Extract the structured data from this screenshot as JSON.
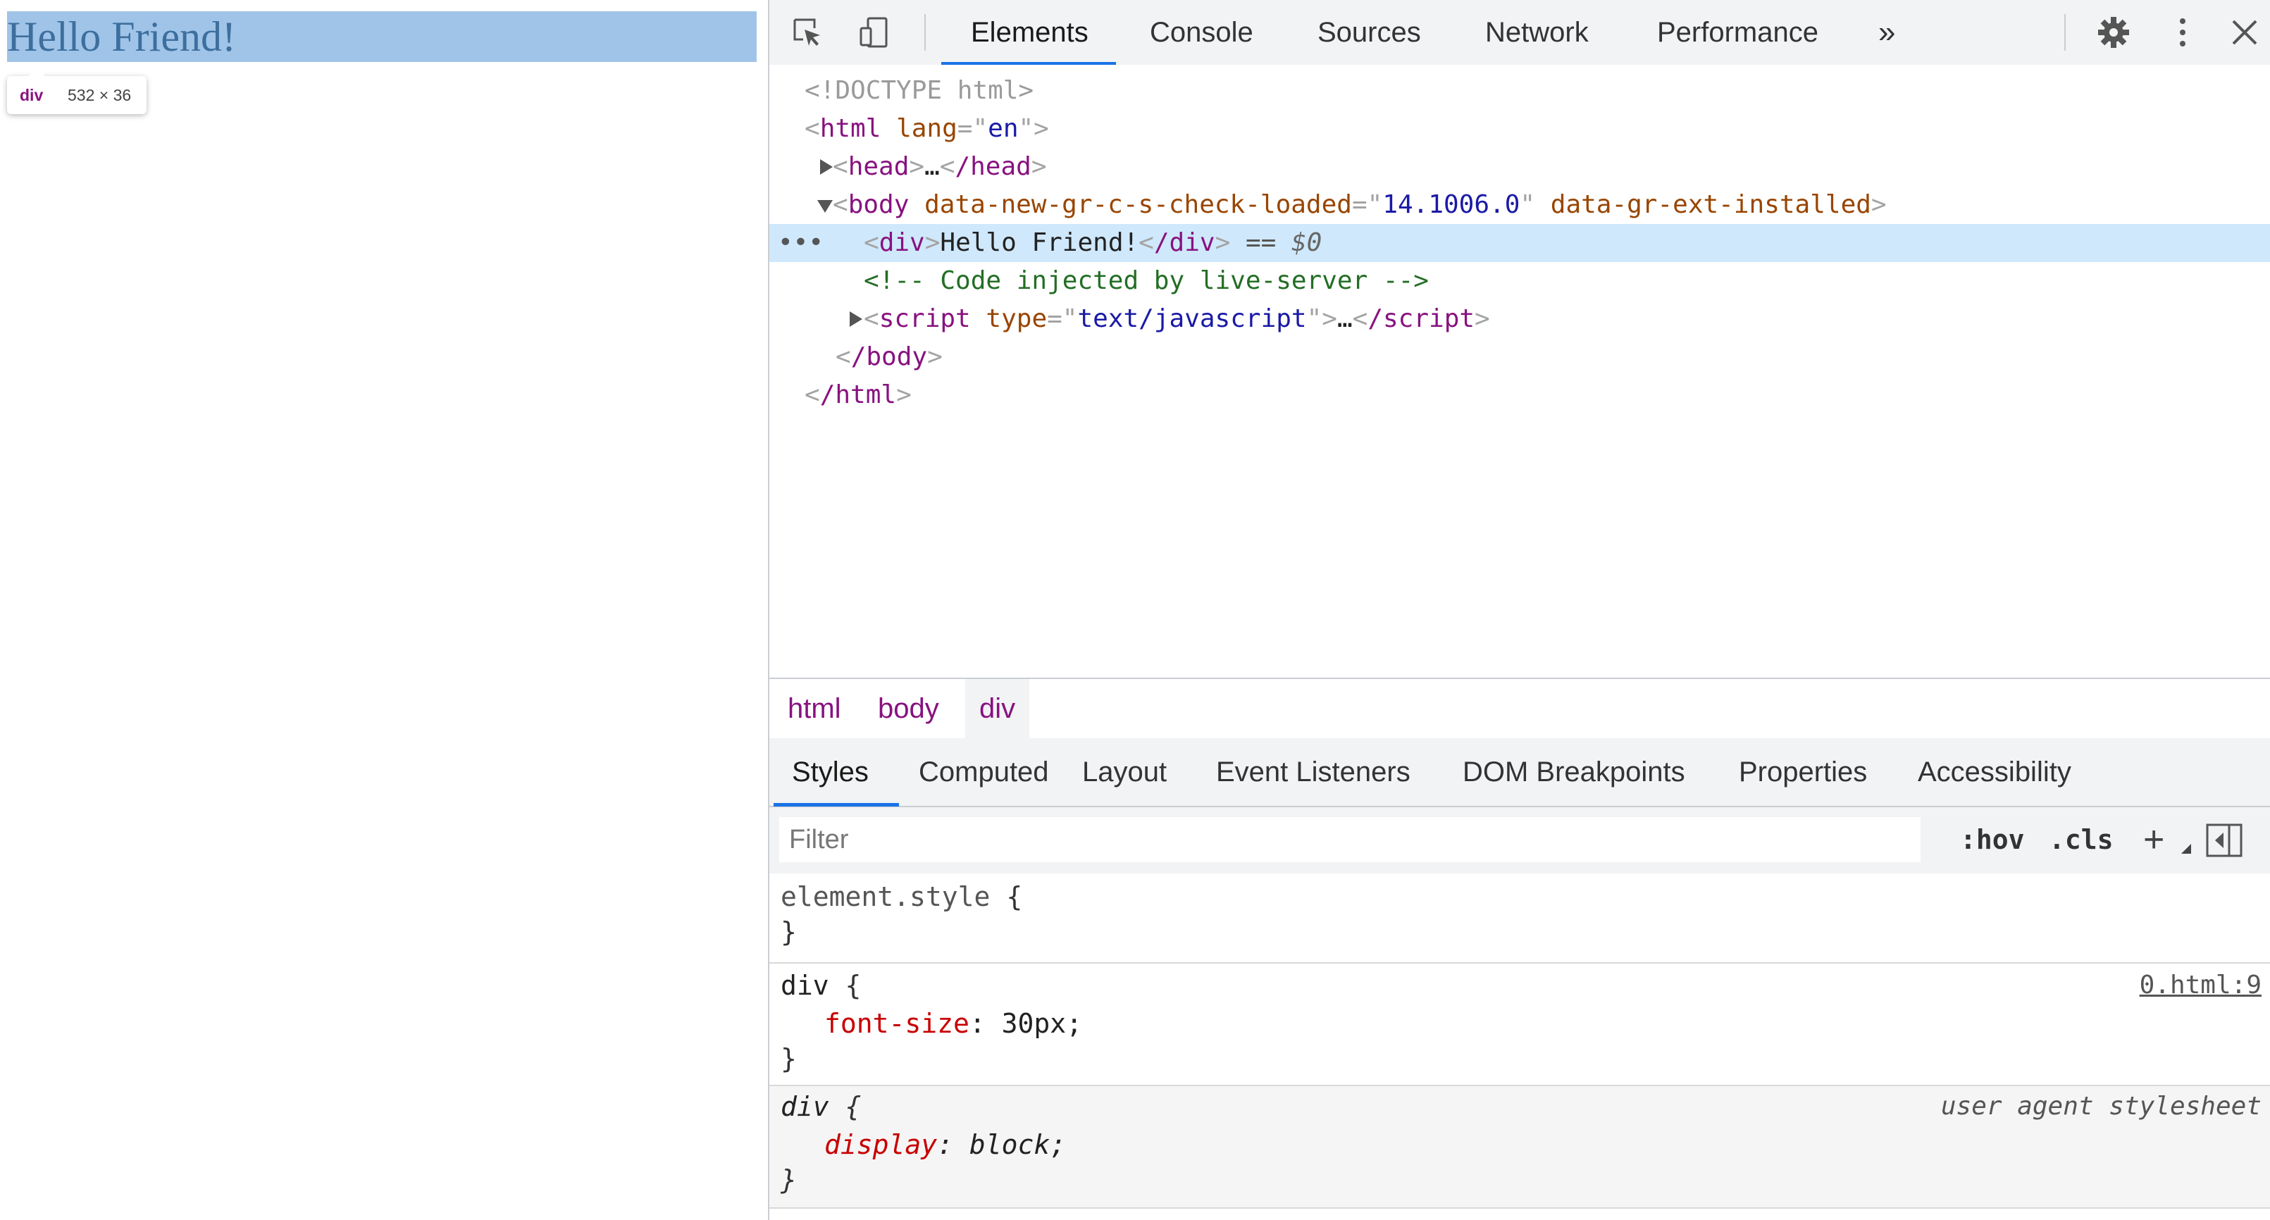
{
  "page": {
    "hello_text": "Hello Friend!",
    "tooltip": {
      "tag": "div",
      "size": "532 × 36"
    }
  },
  "toolbar": {
    "icons": [
      "inspect-element-icon",
      "device-toolbar-icon"
    ],
    "tabs": [
      {
        "label": "Elements",
        "active": true
      },
      {
        "label": "Console"
      },
      {
        "label": "Sources"
      },
      {
        "label": "Network"
      },
      {
        "label": "Performance"
      }
    ],
    "more_tabs": "»",
    "settings": "gear-icon",
    "menu": "kebab-menu-icon",
    "close": "close-icon"
  },
  "dom": {
    "doctype": "<!DOCTYPE html>",
    "html_open": {
      "tag": "html",
      "attr": "lang",
      "val": "en"
    },
    "head": {
      "open": "head",
      "ellipsis": "…",
      "close": "/head"
    },
    "body_open": {
      "tag": "body",
      "attr1": "data-new-gr-c-s-check-loaded",
      "val1": "14.1006.0",
      "attr2": "data-gr-ext-installed"
    },
    "div_line": {
      "tag": "div",
      "text": "Hello Friend!",
      "close": "/div",
      "eq": "==",
      "ref": "$0",
      "dots": "•••"
    },
    "comment": "<!-- Code injected by live-server -->",
    "script": {
      "tag": "script",
      "attr": "type",
      "val": "text/javascript",
      "ellipsis": "…",
      "close": "/script"
    },
    "body_close": "/body",
    "html_close": "/html"
  },
  "breadcrumb": [
    "html",
    "body",
    "div"
  ],
  "styles_tabs": [
    "Styles",
    "Computed",
    "Layout",
    "Event Listeners",
    "DOM Breakpoints",
    "Properties",
    "Accessibility"
  ],
  "filter": {
    "placeholder": "Filter",
    "hov": ":hov",
    "cls": ".cls",
    "add": "+"
  },
  "rules": {
    "element_style": {
      "selector": "element.style",
      "open": "{",
      "close": "}"
    },
    "div_rule": {
      "selector": "div",
      "open": "{",
      "prop": "font-size",
      "value": "30px",
      "close": "}",
      "source": "0.html:9"
    },
    "ua_rule": {
      "selector": "div",
      "open": "{",
      "prop": "display",
      "value": "block",
      "close": "}",
      "source": "user agent stylesheet"
    }
  },
  "colors": {
    "selection": "#a0c4e8",
    "selected_row": "#cfe8fc",
    "accent": "#1a73e8",
    "tag": "#881280"
  }
}
